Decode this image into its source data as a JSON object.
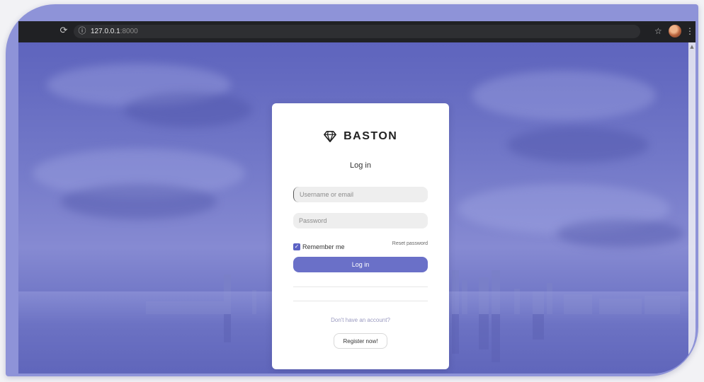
{
  "browser": {
    "url_host": "127.0.0.1",
    "url_port": ":8000",
    "reload_glyph": "⟳",
    "info_glyph": "ⓘ",
    "star_glyph": "☆",
    "menu_glyph": "⋮"
  },
  "login": {
    "brand_name": "BASTON",
    "title": "Log in",
    "username_placeholder": "Username or email",
    "password_placeholder": "Password",
    "remember_label": "Remember me",
    "remember_checked": true,
    "reset_password_label": "Reset password",
    "login_button_label": "Log in",
    "no_account_text": "Don't have an account?",
    "register_button_label": "Register now!"
  },
  "icons": {
    "brand": "diamond-icon",
    "check": "check-icon",
    "reload": "reload-icon",
    "info": "info-icon",
    "star": "star-icon",
    "menu": "kebab-menu-icon",
    "avatar": "profile-avatar"
  },
  "colors": {
    "accent": "#6a70c8",
    "checkbox": "#5b62c4",
    "frame": "#8e93d8",
    "browser_bar": "#202124"
  }
}
